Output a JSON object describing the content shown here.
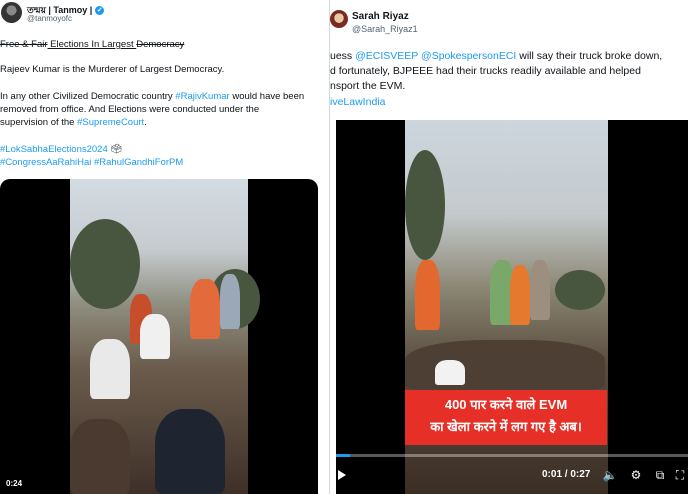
{
  "left_tweet": {
    "author_name": "তন্ময় | Tanmoy |",
    "author_handle": "@tanmoyofc",
    "line1_strike": "Free & Fair",
    "line1_rest": " Elections In Largest ",
    "line1_strike2": "Democracy",
    "line2": "Rajeev Kumar is the Murderer of Largest Democracy.",
    "line3a": "In any other Civilized Democratic country ",
    "line3_tag": "#RajivKumar",
    "line3b": " would have been",
    "line4": "removed from office. And Elections were conducted under the",
    "line5a": "supervision of the ",
    "line5_tag": "#SupremeCourt",
    "line5b": ".",
    "hashtags1": "#LokSabhaElections2024",
    "hashtags2a": "#CongressAaRahiHai",
    "hashtags2b": "#RahulGandhiForPM",
    "video_time": "0:24"
  },
  "right_tweet": {
    "author_name": "Sarah Riyaz",
    "author_handle": "@Sarah_Riyaz1",
    "line1a": "uess ",
    "line1_tag1": "@ECISVEEP",
    "line1_tag2": "@SpokespersonECI",
    "line1b": " will say their truck broke down,",
    "line2": "d fortunately, BJPEEE had their trucks readily available and helped",
    "line3": "nsport the EVM.",
    "line4_tag": "iveLawIndia",
    "caption_line1": "400 पार करने वाले EVM",
    "caption_line2": "का खेला करने में लग गए है अब।",
    "timecode": "0:01 / 0:27",
    "progress": 0.04
  },
  "icons": {
    "volume": "🔈",
    "settings": "⚙",
    "pip": "⧉",
    "fullscreen": "⛶"
  }
}
